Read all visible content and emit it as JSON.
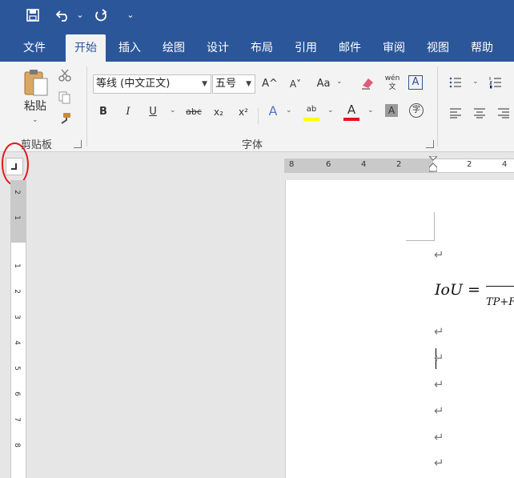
{
  "qat": {
    "save_icon": "save-icon",
    "undo_icon": "undo-icon",
    "undo_caret": "⌄",
    "redo_icon": "redo-icon",
    "customize_icon": "⌄"
  },
  "tabs": [
    {
      "label": "文件",
      "active": false
    },
    {
      "label": "开始",
      "active": true
    },
    {
      "label": "插入",
      "active": false
    },
    {
      "label": "绘图",
      "active": false
    },
    {
      "label": "设计",
      "active": false
    },
    {
      "label": "布局",
      "active": false
    },
    {
      "label": "引用",
      "active": false
    },
    {
      "label": "邮件",
      "active": false
    },
    {
      "label": "审阅",
      "active": false
    },
    {
      "label": "视图",
      "active": false
    },
    {
      "label": "帮助",
      "active": false
    }
  ],
  "ribbon": {
    "clipboard": {
      "paste_label": "粘贴",
      "group_label": "剪贴板"
    },
    "font": {
      "font_name": "等线 (中文正文)",
      "font_size": "五号",
      "bold": "B",
      "italic": "I",
      "underline": "U",
      "strikethrough": "abc",
      "subscript": "x₂",
      "superscript": "x²",
      "grow": "A^",
      "shrink": "A˅",
      "change_case": "Aa",
      "phonetic": "wén 文",
      "border_char": "A",
      "font_color": "A",
      "highlight": "ab",
      "shading": "A",
      "enclose": "字",
      "group_label": "字体"
    }
  },
  "ruler": {
    "horizontal": [
      "8",
      "6",
      "4",
      "2",
      "2",
      "4"
    ],
    "vertical_top": [
      "2",
      "1"
    ],
    "vertical": [
      "1",
      "2",
      "3",
      "4",
      "5",
      "6",
      "7",
      "8"
    ]
  },
  "document": {
    "para_mark": "↵",
    "equation_lhs": "IoU",
    "equation_eq": "=",
    "equation_denominator": "TP+F"
  },
  "colors": {
    "title_blue": "#2b579a",
    "ribbon_bg": "#f3f3f3",
    "annotation_red": "#e0191b",
    "font_color_red": "#e81123",
    "highlight_yellow": "#ffff00"
  }
}
